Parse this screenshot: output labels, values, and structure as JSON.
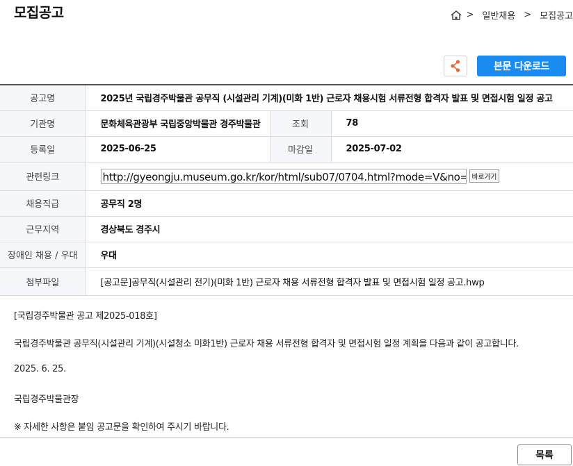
{
  "page": {
    "title": "모집공고"
  },
  "breadcrumb": {
    "home_icon": "home-icon",
    "sep1": ">",
    "item1": "일반채용",
    "sep2": ">",
    "item2": "모집공고"
  },
  "toolbar": {
    "share_icon": "share-icon",
    "download_label": "본문 다운로드"
  },
  "info": {
    "title_label": "공고명",
    "title_value": "2025년 국립경주박물관 공무직 (시설관리 기계)(미화 1반) 근로자 채용시험 서류전형 합격자 발표 및 면접시험 일정 공고",
    "agency_label": "기관명",
    "agency_value": "문화체육관광부 국립중앙박물관 경주박물관",
    "views_label": "조회",
    "views_value": "78",
    "reg_label": "등록일",
    "reg_value": "2025-06-25",
    "deadline_label": "마감일",
    "deadline_value": "2025-07-02",
    "link_label": "관련링크",
    "link_value": "http://gyeongju.museum.go.kr/kor/html/sub07/0704.html?mode=V&no=",
    "link_go": "바로가기",
    "position_label": "채용직급",
    "position_value": "공무직 2명",
    "region_label": "근무지역",
    "region_value": "경상북도 경주시",
    "disabled_label": "장애인 채용 / 우대",
    "disabled_value": "우대",
    "attach_label": "첨부파일",
    "attach_value": "[공고문]공무직(시설관리 전기)(미화 1반) 근로자 채용 서류전형 합격자 발표 및 면접시험 일정 공고.hwp"
  },
  "body": {
    "line1": "[국립경주박물관 공고 제2025-018호]",
    "line2": "국립경주박물관 공무직(시설관리 기계)(시설청소 미화1반) 근로자 채용 서류전형 합격자 및 면접시험 일정 계획을 다음과 같이 공고합니다.",
    "line3": "2025. 6. 25.",
    "line4": "국립경주박물관장",
    "line5": "※ 자세한 사항은 붙임 공고문을 확인하여 주시기 바랍니다."
  },
  "footer": {
    "list_label": "목록"
  }
}
